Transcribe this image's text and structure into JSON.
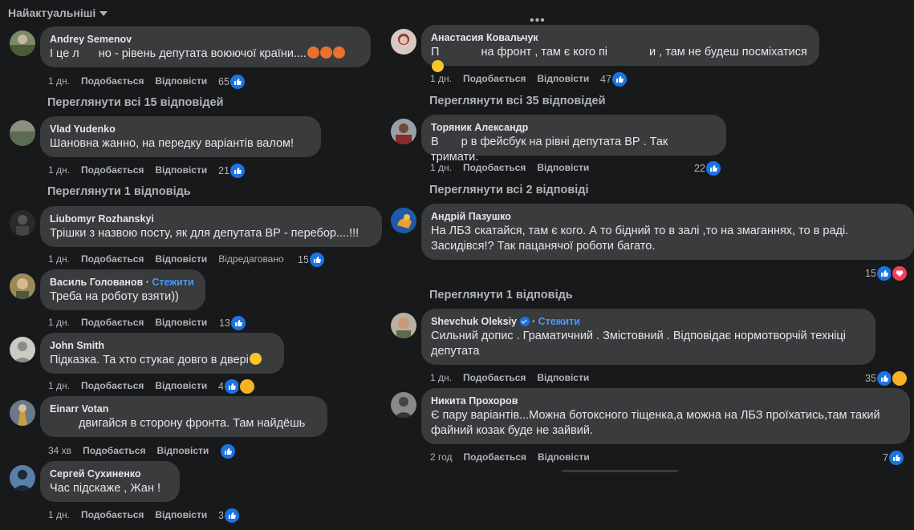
{
  "sort": {
    "label": "Найактуальніші",
    "icon": "chevron-down-icon"
  },
  "actions_labels": {
    "like": "Подобається",
    "reply": "Відповісти",
    "edited": "Відредаговано",
    "follow": "Стежити"
  },
  "left": [
    {
      "author": "Andrey Semenov",
      "text_a": "І це л",
      "text_b": "но - рівень депутата воюючої країни....",
      "time": "1 дн.",
      "count": "65",
      "replies": "Переглянути всі 15 відповідей"
    },
    {
      "author": "Vlad Yudenko",
      "text": "Шановна жанно, на передку варіантів валом!",
      "time": "1 дн.",
      "count": "21",
      "replies": "Переглянути 1 відповідь"
    },
    {
      "author": "Liubomyr Rozhanskyi",
      "text": "Трішки з назвою посту, як для депутата ВР - перебор....!!!",
      "time": "1 дн.",
      "count": "15",
      "edited": "Відредаговано"
    },
    {
      "author": "Василь Голованов",
      "follow": "Стежити",
      "text": "Треба на роботу взяти))",
      "time": "1 дн.",
      "count": "13"
    },
    {
      "author": "John Smith",
      "text": "Підказка. Та хто стукає довго в двері",
      "time": "1 дн.",
      "count": "4"
    },
    {
      "author": "Einarr Votan",
      "text": "двигайся в сторону фронта. Там найдёшь",
      "time": "34 хв",
      "count": ""
    },
    {
      "author": "Сергей Сухиненко",
      "text": "Час підскаже , Жан !",
      "time": "1 дн.",
      "count": "3"
    }
  ],
  "right": [
    {
      "author": "Анастасия Ковальчук",
      "text_a": "П",
      "text_b": " на фронт , там є кого пі",
      "text_c": "и , там не будеш посміхатися",
      "time": "1 дн.",
      "count": "47",
      "replies": "Переглянути всі 35 відповідей"
    },
    {
      "author": "Торяник Александр",
      "text_a": "В",
      "text_b": "р в фейсбук на рівні депутата ВР . Так тримати.",
      "time": "1 дн.",
      "count": "22",
      "replies": "Переглянути всі 2 відповіді"
    },
    {
      "author": "Андрій Пазушко",
      "text": "На ЛБЗ скатайся, там є кого. А то бідний то в залі ,то на змаганнях, то в раді. Засидівся!? Так пацанячої роботи багато.",
      "time": "",
      "count": "15",
      "replies": "Переглянути 1 відповідь"
    },
    {
      "author": "Shevchuk Oleksiy",
      "follow": "Стежити",
      "text": "Сильний допис . Граматичний . Змістовний . Відповідає нормотворчій техніці депутата",
      "time": "1 дн.",
      "count": "35"
    },
    {
      "author": "Никита Прохоров",
      "text": "Є пару варіантів...Можна ботоксного тіщенка,а можна на ЛБЗ проїхатись,там такий файний козак буде не зайвий.",
      "time": "2 год",
      "count": "7"
    }
  ],
  "colors": {
    "bg": "#18191a",
    "bubble": "#3a3b3c",
    "link": "#4599ff",
    "like": "#1b74e4",
    "love": "#f33e58",
    "haha": "#f7b125"
  }
}
